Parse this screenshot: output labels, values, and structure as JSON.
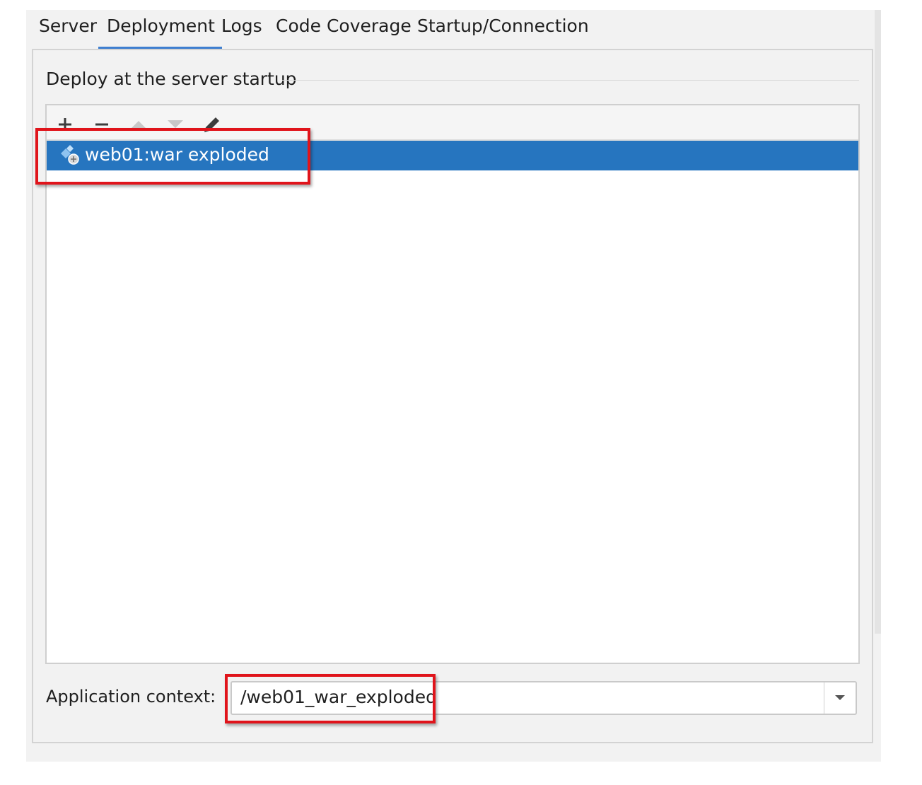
{
  "tabs": [
    {
      "label": "Server"
    },
    {
      "label": "Deployment"
    },
    {
      "label": "Logs"
    },
    {
      "label": "Code Coverage"
    },
    {
      "label": "Startup/Connection"
    }
  ],
  "active_tab": "Deployment",
  "deploy_section": {
    "title": "Deploy at the server startup",
    "toolbar": {
      "add": "add-icon",
      "remove": "remove-icon",
      "move_up": "arrow-up-icon",
      "move_down": "arrow-down-icon",
      "edit": "pencil-icon"
    },
    "artifacts": [
      {
        "label": "web01:war exploded",
        "icon": "artifact-icon",
        "selected": true
      }
    ]
  },
  "application_context": {
    "label": "Application context:",
    "value": "/web01_war_exploded"
  },
  "colors": {
    "selection": "#2675bf",
    "tab_underline": "#3f7fd0",
    "annotation": "#e0141b"
  }
}
